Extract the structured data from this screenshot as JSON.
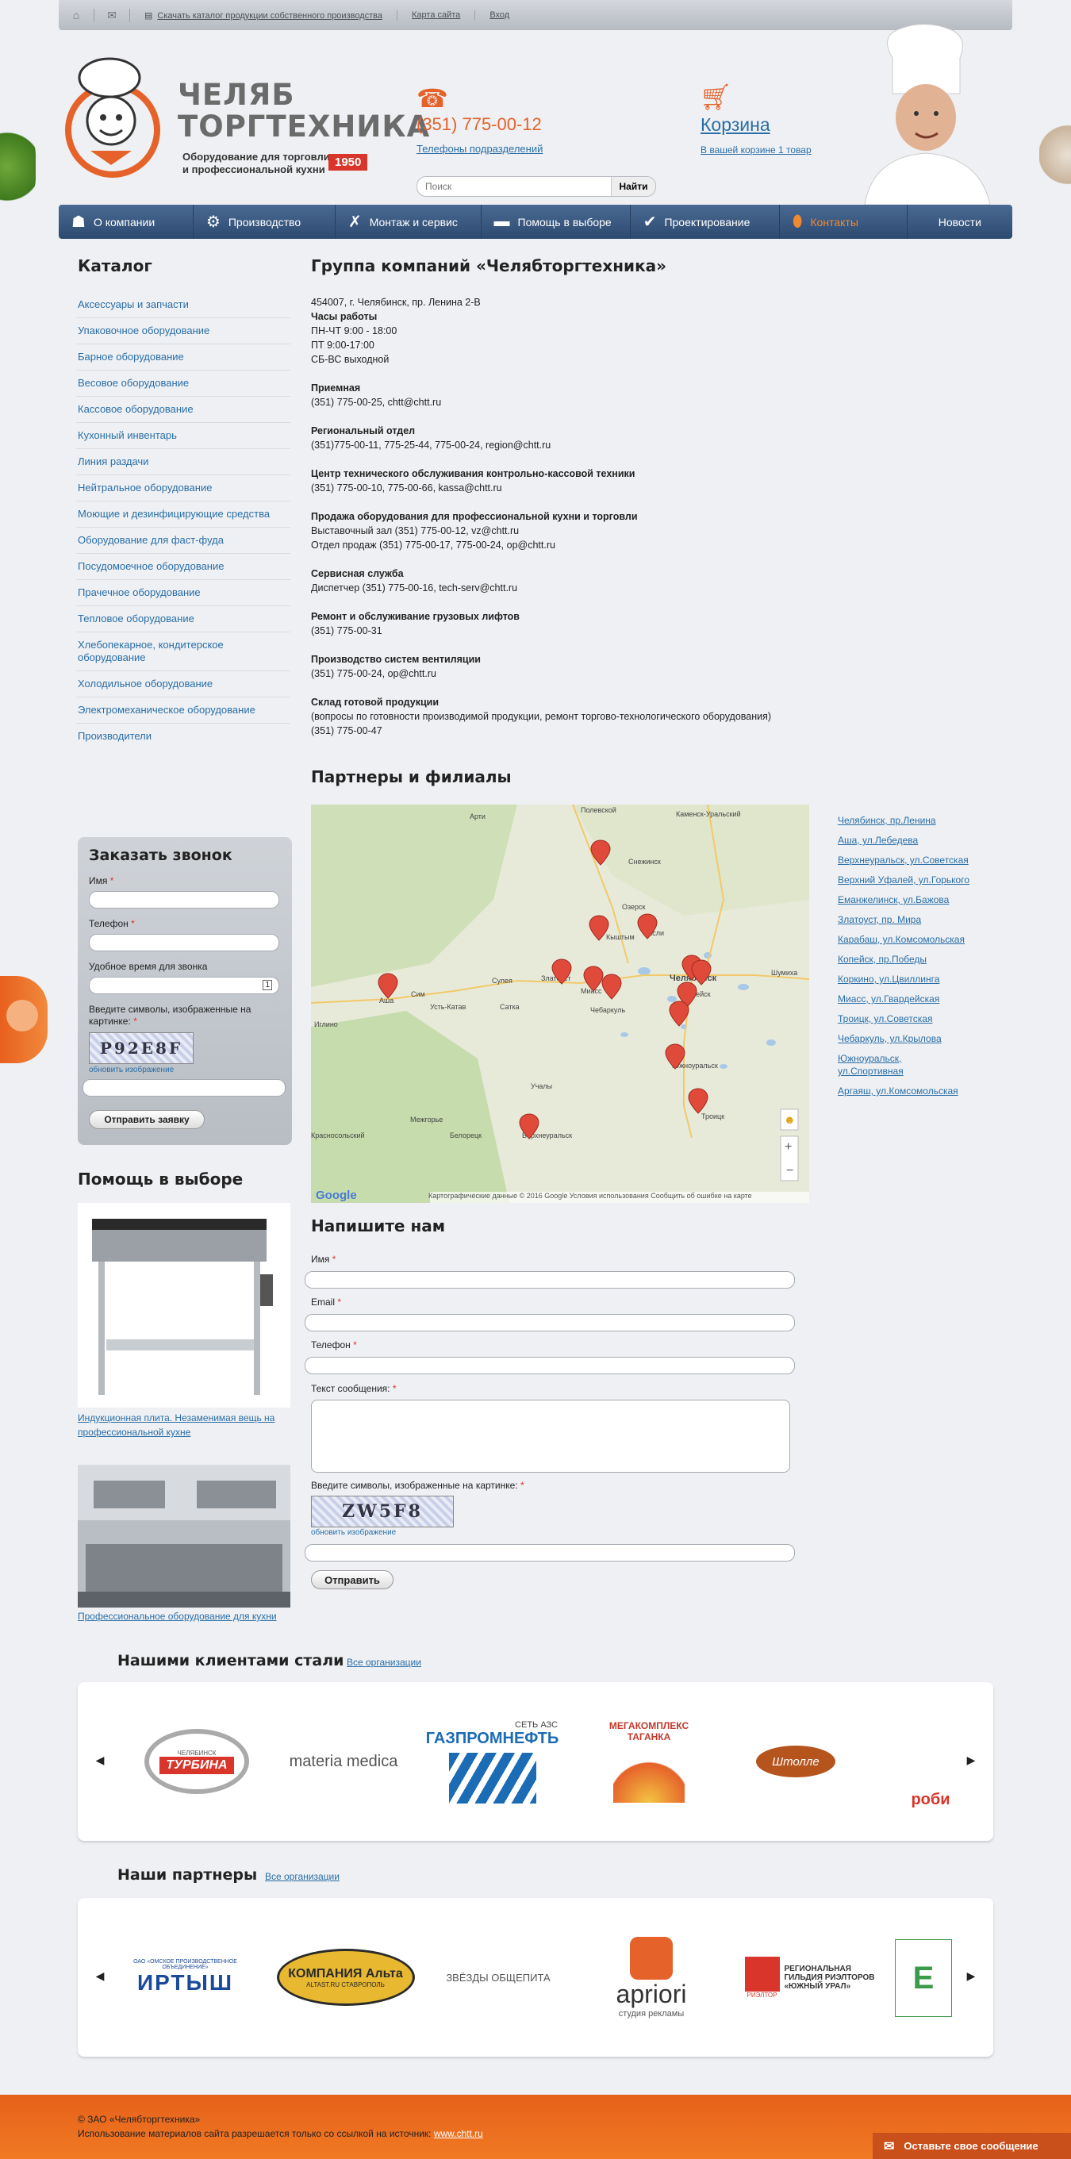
{
  "topbar": {
    "links": [
      "Скачать каталог продукции собственного производства",
      "Карта сайта",
      "Вход"
    ]
  },
  "header": {
    "logo_title_line1": "ЧЕЛЯБ",
    "logo_title_line2": "ТОРГТЕХНИКА",
    "logo_sub_line1": "Оборудование для торговли",
    "logo_sub_line2": "и профессиональной кухни",
    "logo_year": "1950",
    "phone": "(351) 775-00-12",
    "phone_link": "Телефоны подразделений",
    "cart_title": "Корзина",
    "cart_sub": "В вашей корзине 1 товар",
    "search_placeholder": "Поиск",
    "search_button": "Найти"
  },
  "nav": [
    {
      "label": "О компании",
      "icon": "chef-hat-icon",
      "glyph": "☗"
    },
    {
      "label": "Производство",
      "icon": "gear-icon",
      "glyph": "⚙"
    },
    {
      "label": "Монтаж и сервис",
      "icon": "tools-icon",
      "glyph": "✗"
    },
    {
      "label": "Помощь в выборе",
      "icon": "chat-icon",
      "glyph": "▬"
    },
    {
      "label": "Проектирование",
      "icon": "check-icon",
      "glyph": "✔"
    },
    {
      "label": "Контакты",
      "icon": "location-pin-icon",
      "glyph": "⬮"
    },
    {
      "label": "Новости",
      "icon": "",
      "glyph": ""
    }
  ],
  "catalog": {
    "title": "Каталог",
    "items": [
      "Аксессуары и запчасти",
      "Упаковочное оборудование",
      "Барное оборудование",
      "Весовое оборудование",
      "Кассовое оборудование",
      "Кухонный инвентарь",
      "Линия раздачи",
      "Нейтральное оборудование",
      "Моющие и дезинфицирующие средства",
      "Оборудование для фаст-фуда",
      "Посудомоечное оборудование",
      "Прачечное оборудование",
      "Тепловое оборудование",
      "Хлебопекарное, кондитерское оборудование",
      "Холодильное оборудование",
      "Электромеханическое оборудование",
      "Производители"
    ]
  },
  "callback": {
    "title": "Заказать звонок",
    "name_label": "Имя",
    "phone_label": "Телефон",
    "time_label": "Удобное время для звонка",
    "captcha_label": "Введите символы, изображенные на картинке:",
    "captcha_text": "P92Е8F",
    "refresh": "обновить изображение",
    "submit": "Отправить заявку"
  },
  "help": {
    "title": "Помощь в выборе",
    "item1": "Индукционная плита. Незаменимая вещь на профессиональной кухне",
    "item2": "Профессиональное оборудование для кухни"
  },
  "main": {
    "title": "Группа компаний «Челябторгтехника»",
    "address": "454007, г. Челябинск, пр. Ленина 2-В",
    "hours_title": "Часы работы",
    "hours": [
      "ПН-ЧТ 9:00 - 18:00",
      "ПТ 9:00-17:00",
      "СБ-ВС выходной"
    ],
    "blocks": [
      {
        "title": "Приемная",
        "lines": [
          "(351) 775-00-25, chtt@chtt.ru"
        ]
      },
      {
        "title": "Региональный отдел",
        "lines": [
          "(351)775-00-11, 775-25-44, 775-00-24, region@chtt.ru"
        ]
      },
      {
        "title": "Центр технического обслуживания контрольно-кассовой техники",
        "lines": [
          "(351) 775-00-10, 775-00-66, kassa@chtt.ru"
        ]
      },
      {
        "title": "Продажа оборудования для профессиональной кухни и торговли",
        "lines": [
          "Выставочный зал (351) 775-00-12, vz@chtt.ru",
          "Отдел продаж (351) 775-00-17, 775-00-24, op@chtt.ru"
        ]
      },
      {
        "title": "Сервисная служба",
        "lines": [
          "Диспетчер (351) 775-00-16, tech-serv@chtt.ru"
        ]
      },
      {
        "title": "Ремонт и обслуживание грузовых лифтов",
        "lines": [
          "(351) 775-00-31"
        ]
      },
      {
        "title": "Производство систем вентиляции",
        "lines": [
          "(351) 775-00-24, op@chtt.ru"
        ]
      },
      {
        "title": "Склад готовой продукции",
        "lines": [
          "(вопросы по готовности производимой продукции, ремонт торгово-технологического оборудования)",
          "(351) 775-00-47"
        ]
      }
    ]
  },
  "partners": {
    "title": "Партнеры и филиалы",
    "branches": [
      "Челябинск, пр.Ленина",
      "Аша, ул.Лебедева",
      "Верхнеуральск, ул.Советская",
      "Верхний Уфалей, ул.Горького",
      "Еманжелинск, ул.Бажова",
      "Златоуст, пр. Мира",
      "Карабаш, ул.Комсомольская",
      "Копейск, пр.Победы",
      "Коркино, ул.Цвиллинга",
      "Миасс, ул.Гвардейская",
      "Троицк, ул.Советская",
      "Чебаркуль, ул.Крылова",
      "Южноуральск, ул.Спортивная",
      "Аргаяш, ул.Комсомольская"
    ],
    "map_places": [
      "Полевской",
      "Каменск-Уральский",
      "Арти",
      "Снежинск",
      "Озерск",
      "Касли",
      "Кыштым",
      "Сатка",
      "Сулея",
      "Златоуст",
      "Миасс",
      "Чебаркуль",
      "Челябинск",
      "Копейск",
      "Аша",
      "Сим",
      "Усть-Катав",
      "Иглино",
      "Южноуральск",
      "Троицк",
      "Белорецк",
      "Учалы",
      "Межгорье",
      "Верхнеуральск",
      "Шумиха",
      "Красносольский"
    ],
    "map_attr": "Картографические данные © 2016 Google   Условия использования   Сообщить об ошибке на карте",
    "google": "Google"
  },
  "write": {
    "title": "Напишите нам",
    "name_label": "Имя",
    "email_label": "Email",
    "phone_label": "Телефон",
    "message_label": "Текст сообщения:",
    "captcha_label": "Введите символы, изображенные на картинке:",
    "captcha_text": "ZW5F8",
    "refresh": "обновить изображение",
    "submit": "Отправить"
  },
  "clients": {
    "title": "Нашими клиентами стали",
    "link": "Все организации",
    "logos": [
      "ТУРБИНА",
      "materia medica",
      "ГАЗПРОМНЕФТЬ",
      "МЕГАКОМПЛЕКС ТАГАНКА",
      "Штолле",
      "роби"
    ],
    "logo_sub": [
      "ЧЕЛЯБИНСК",
      "",
      "СЕТЬ АЗС",
      "",
      "",
      ""
    ]
  },
  "partners_logos": {
    "title": "Наши партнеры",
    "link": "Все организации",
    "logos": [
      "ИРТЫШ",
      "КОМПАНИЯ Альта",
      "ЗВЁЗДЫ ОБЩЕПИТА",
      "apriori",
      "РЕГИОНАЛЬНАЯ ГИЛЬДИЯ РИЭЛТОРОВ «ЮЖНЫЙ УРАЛ»",
      "Е"
    ],
    "logo_sub": [
      "ОАО «ОМСКОЕ ПРОИЗВОДСТВЕННОЕ ОБЪЕДИНЕНИЕ»",
      "ALTAST.RU СТАВРОПОЛЬ",
      "",
      "студия рекламы",
      "РИЭЛТОР",
      ""
    ]
  },
  "footer": {
    "copyright": "© ЗАО «Челябторгтехника»",
    "notice": "Использование материалов сайта разрешается только со ссылкой на источник:",
    "site": "www.chtt.ru",
    "message_button": "Оставьте свое сообщение"
  },
  "colors": {
    "accent": "#e5622a",
    "nav": "#2d4a70",
    "link": "#2a6ea7",
    "footer": "#f07a24"
  }
}
